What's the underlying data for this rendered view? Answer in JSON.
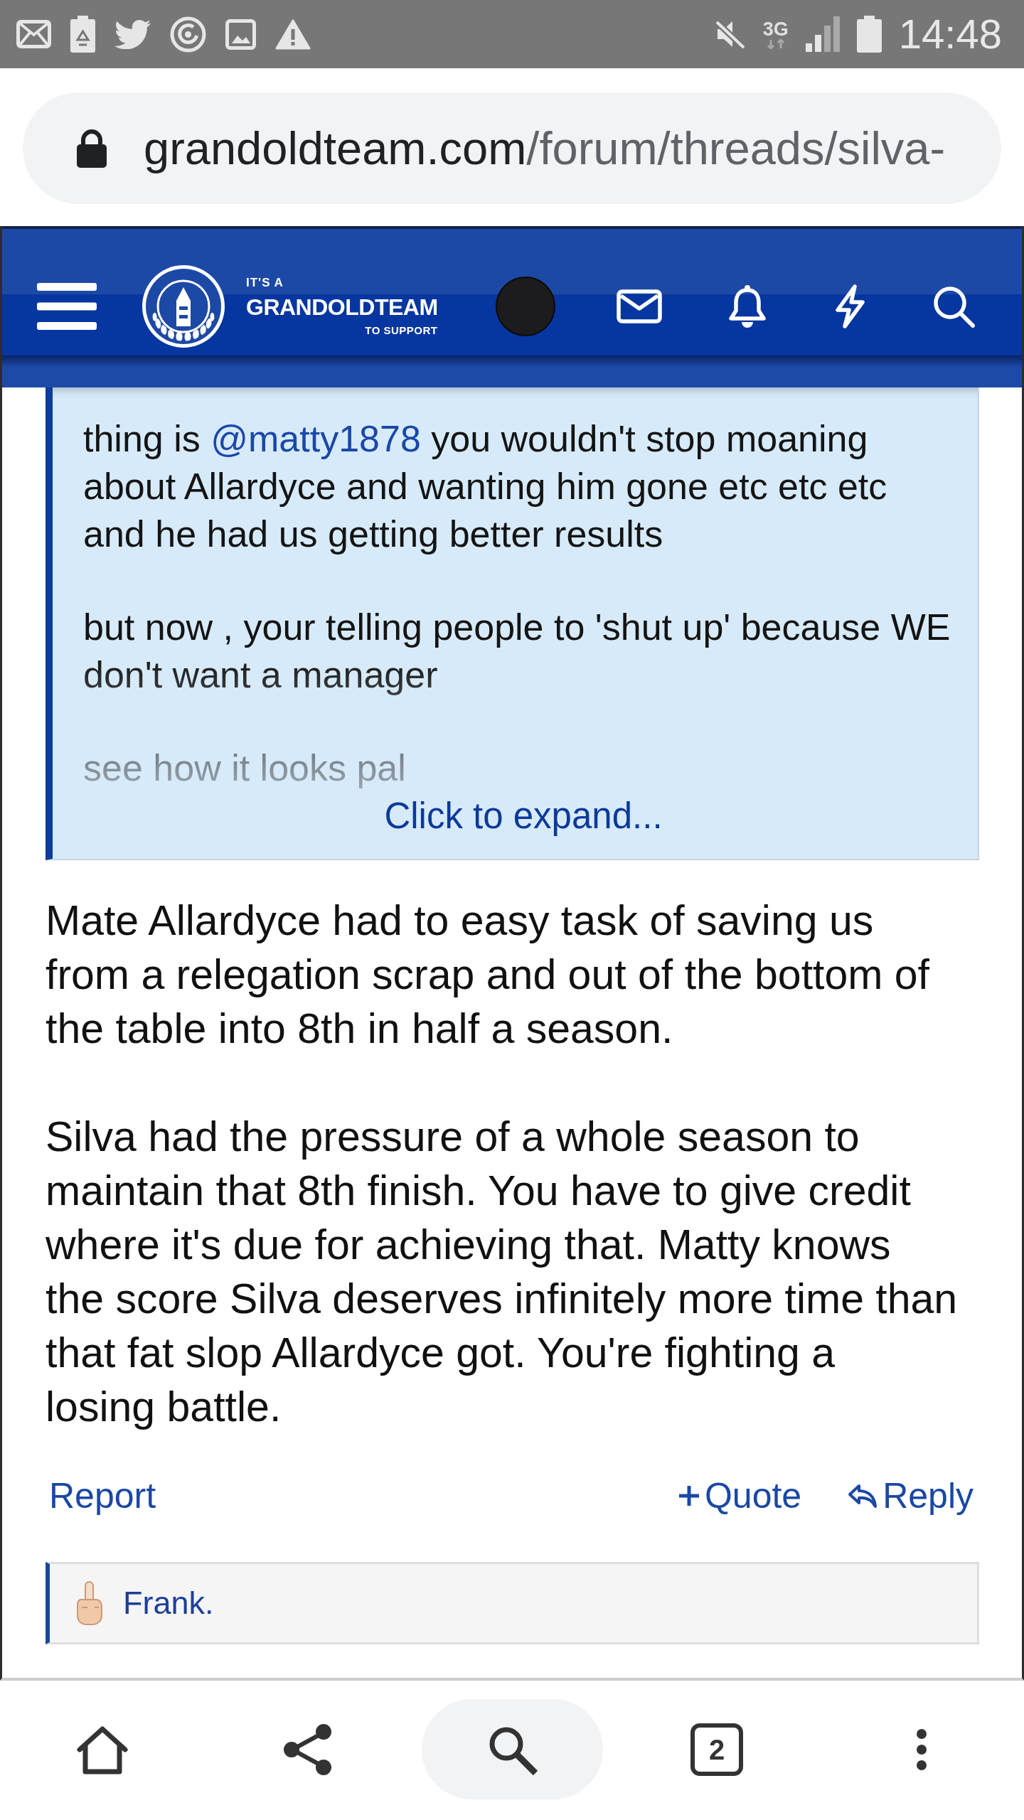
{
  "status_bar": {
    "network": "3G",
    "time": "14:48"
  },
  "address_bar": {
    "domain": "grandoldteam.com",
    "path": "/forum/threads/silva-"
  },
  "site_header": {
    "logo": {
      "line_1": "IT'S A",
      "line_2": "GRANDOLDTEAM",
      "line_3": "TO SUPPORT"
    }
  },
  "quote": {
    "expanded": false,
    "paragraphs": [
      {
        "lines": [
          [
            {
              "kind": "text",
              "text": "thing is "
            },
            {
              "kind": "mention",
              "text": "@matty1878"
            },
            {
              "kind": "text",
              "text": " you wouldn't stop moaning"
            }
          ],
          [
            {
              "kind": "text",
              "text": "about Allardyce and wanting him gone etc etc etc"
            }
          ],
          [
            {
              "kind": "text",
              "text": "and he had us getting better results"
            }
          ]
        ]
      },
      {
        "lines": [
          [
            {
              "kind": "text",
              "text": "but now , your telling people to 'shut up' because WE"
            }
          ],
          [
            {
              "kind": "text",
              "text": "don't want a manager"
            }
          ]
        ]
      },
      {
        "lines": [
          [
            {
              "kind": "text",
              "text": "see how it looks pal"
            }
          ]
        ]
      }
    ],
    "expand_link": "Click to expand..."
  },
  "post": {
    "paragraphs": [
      {
        "lines": [
          "Mate Allardyce had to easy task of saving us",
          "from a relegation scrap and out of the bottom of",
          "the table into 8th in half a season."
        ]
      },
      {
        "lines": [
          "Silva had the pressure of a whole season to",
          "maintain that 8th finish. You have to give credit",
          "where it's due for achieving that. Matty knows",
          "the score Silva deserves infinitely more time than",
          "that fat slop Allardyce got. You're fighting a",
          "losing battle."
        ]
      }
    ],
    "actions": [
      {
        "kind": "report",
        "label": "Report"
      },
      {
        "kind": "quote",
        "label": "Quote"
      },
      {
        "kind": "reply",
        "label": "Reply"
      }
    ]
  },
  "signature": {
    "text": "Frank."
  },
  "browser_toolbar": {
    "tab_count": "2"
  }
}
